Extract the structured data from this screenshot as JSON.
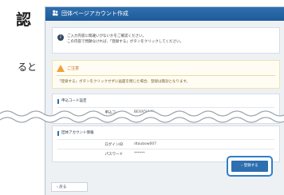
{
  "left_doc": {
    "heading": "認",
    "text": "ると"
  },
  "window": {
    "title": "団体ページアカウント作成"
  },
  "info": {
    "line1": "ご入力内容に間違いがないかをご確認ください。",
    "line2": "この内容で問題なければ、「登録する」ボタンをクリックしてください。"
  },
  "warning": {
    "title": "ご注意",
    "message": "「登録する」ボタンをクリックせずに画面を閉じた場合、登録は無効となります。"
  },
  "group1": {
    "section": "申込コード設定",
    "label": "申込コード",
    "value": "BEXA5UUN"
  },
  "group2": {
    "section": "団体アカウント情報",
    "login_label": "ログインID",
    "login_value": "dtaubow007",
    "password_label": "パスワード",
    "password_value": "******"
  },
  "buttons": {
    "register": "登録する",
    "back": "戻る"
  },
  "colors": {
    "primary": "#2e6fb0",
    "warning": "#f0a13a"
  }
}
